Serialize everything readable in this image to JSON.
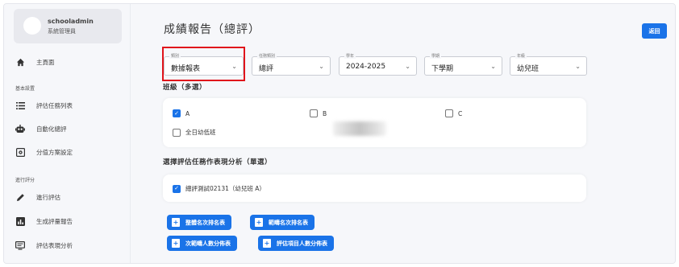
{
  "user": {
    "name": "schooladmin",
    "role": "系統管理員"
  },
  "sidebar": {
    "home": {
      "label": "主頁面",
      "icon": "home-icon"
    },
    "section_basic": "基本設置",
    "items_basic": [
      {
        "label": "評估任務列表",
        "icon": "list-icon"
      },
      {
        "label": "自動化總評",
        "icon": "robot-icon"
      },
      {
        "label": "分值方案設定",
        "icon": "settings-box-icon"
      }
    ],
    "section_eval": "進行評分",
    "items_eval": [
      {
        "label": "進行評估",
        "icon": "pencil-icon"
      },
      {
        "label": "生成評量報告",
        "icon": "bar-chart-icon"
      },
      {
        "label": "評估表現分析",
        "icon": "monitor-icon"
      }
    ]
  },
  "header": {
    "title": "成績報告（總評）",
    "back_label": "返回"
  },
  "filters": [
    {
      "legend": "類別",
      "value": "數據報表"
    },
    {
      "legend": "任務類別",
      "value": "總評"
    },
    {
      "legend": "學年",
      "value": "2024-2025"
    },
    {
      "legend": "學期",
      "value": "下學期"
    },
    {
      "legend": "年級",
      "value": "幼兒班"
    }
  ],
  "class_section": {
    "title": "班級（多選）",
    "options": [
      {
        "label": "A",
        "checked": true
      },
      {
        "label": "B",
        "checked": false
      },
      {
        "label": "C",
        "checked": false
      },
      {
        "label": "全日幼低班",
        "checked": false
      }
    ]
  },
  "task_section": {
    "title": "選擇評估任務作表現分析（單選）",
    "option": {
      "label": "總評測試02131（幼兒班 A）",
      "checked": true
    }
  },
  "report_buttons": [
    "整體名次排名表",
    "範疇名次排名表",
    "次範疇人數分佈表",
    "評估項目人數分佈表"
  ],
  "colors": {
    "primary": "#1a73e8",
    "highlight": "#e0141b"
  }
}
